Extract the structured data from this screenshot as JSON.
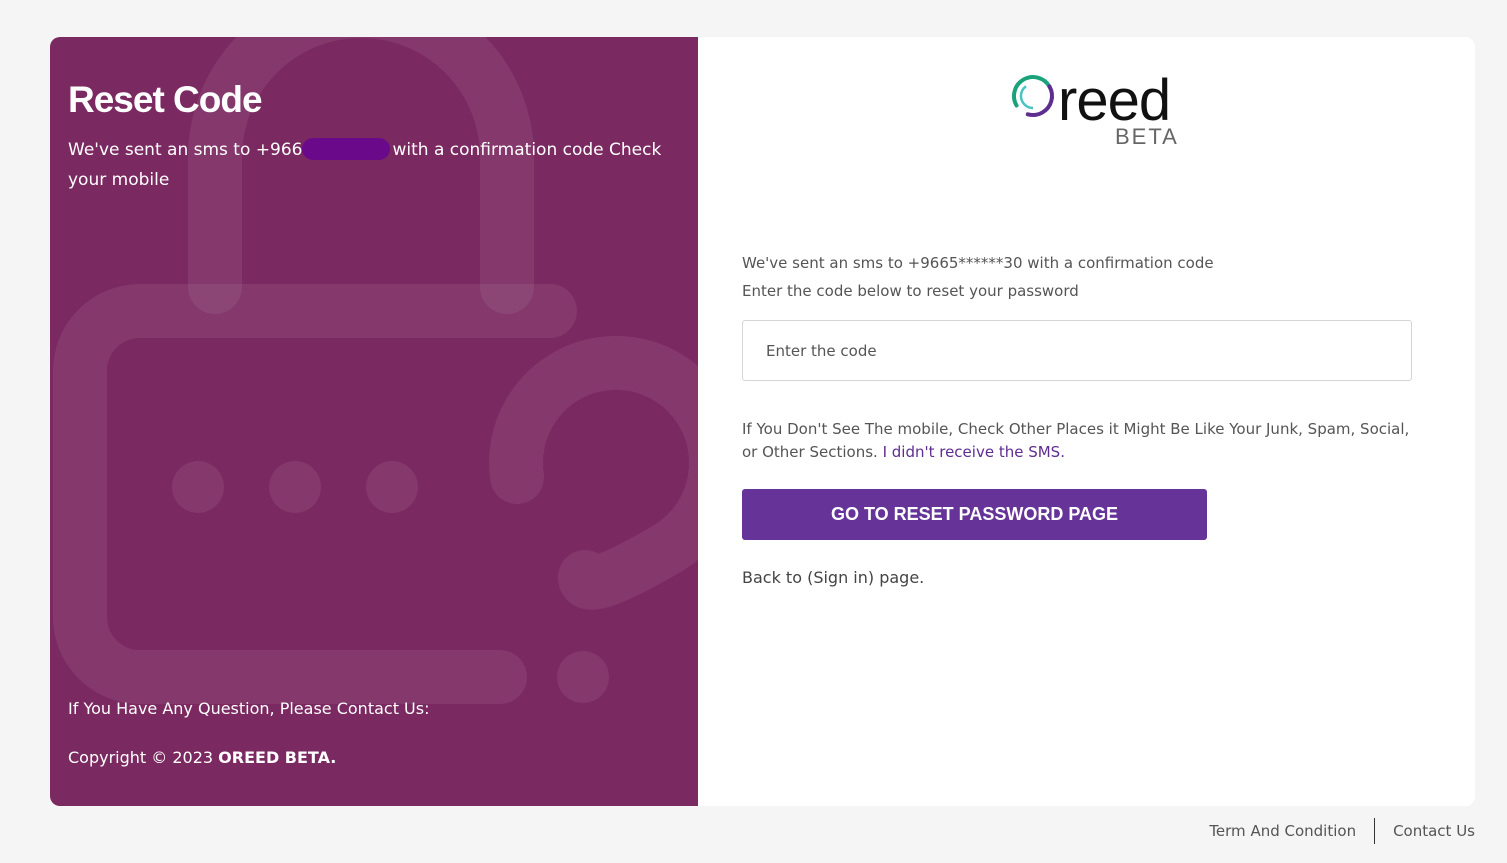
{
  "left_panel": {
    "title": "Reset Code",
    "msg_prefix": "We've sent an sms to +966",
    "msg_suffix": "with a confirmation code Check your mobile",
    "contact_text": "If You Have Any Question, Please Contact Us:",
    "copyright_prefix": "Copyright © 2023 ",
    "copyright_brand": "OREED BETA.",
    "background_color": "#7b2961"
  },
  "logo": {
    "word": "reed",
    "beta": "BETA"
  },
  "form": {
    "info_line1": "We've sent an sms to +9665******30 with a confirmation code",
    "info_line2": "Enter the code below to reset your password",
    "code_placeholder": "Enter the code",
    "code_value": "",
    "hint_text": "If You Don't See The mobile, Check Other Places it Might Be Like Your Junk, Spam, Social, or Other Sections. ",
    "resend_link": "I didn't receive the SMS.",
    "submit_label": "GO TO RESET PASSWORD PAGE",
    "back_text": "Back to (Sign in) page.",
    "accent_color": "#663399"
  },
  "footer": {
    "terms_label": "Term And Condition",
    "contact_label": "Contact Us"
  }
}
